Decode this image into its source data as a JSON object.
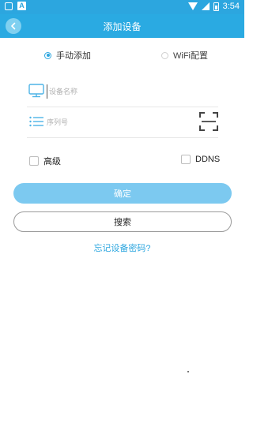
{
  "status_bar": {
    "time": "3:54",
    "icons": [
      "notification-box-icon",
      "app-a-icon",
      "wifi-icon",
      "signal-icon",
      "battery-icon"
    ]
  },
  "header": {
    "title": "添加设备",
    "back_icon": "chevron-left-icon"
  },
  "mode_selector": {
    "manual_label": "手动添加",
    "wifi_label": "WiFi配置",
    "selected": "manual"
  },
  "form": {
    "device_name": {
      "value": "",
      "placeholder": "设备名称",
      "icon": "monitor-icon"
    },
    "serial_number": {
      "value": "",
      "placeholder": "序列号",
      "icon": "list-icon"
    },
    "scan_icon": "qr-scan-icon"
  },
  "options": {
    "advanced_label": "高级",
    "advanced_checked": false,
    "ddns_label": "DDNS",
    "ddns_checked": false
  },
  "actions": {
    "confirm_label": "确定",
    "search_label": "搜索",
    "forgot_password_label": "忘记设备密码?"
  },
  "colors": {
    "primary": "#2aaae2",
    "confirm_button": "#7cc9f0",
    "link": "#2ca6df"
  }
}
